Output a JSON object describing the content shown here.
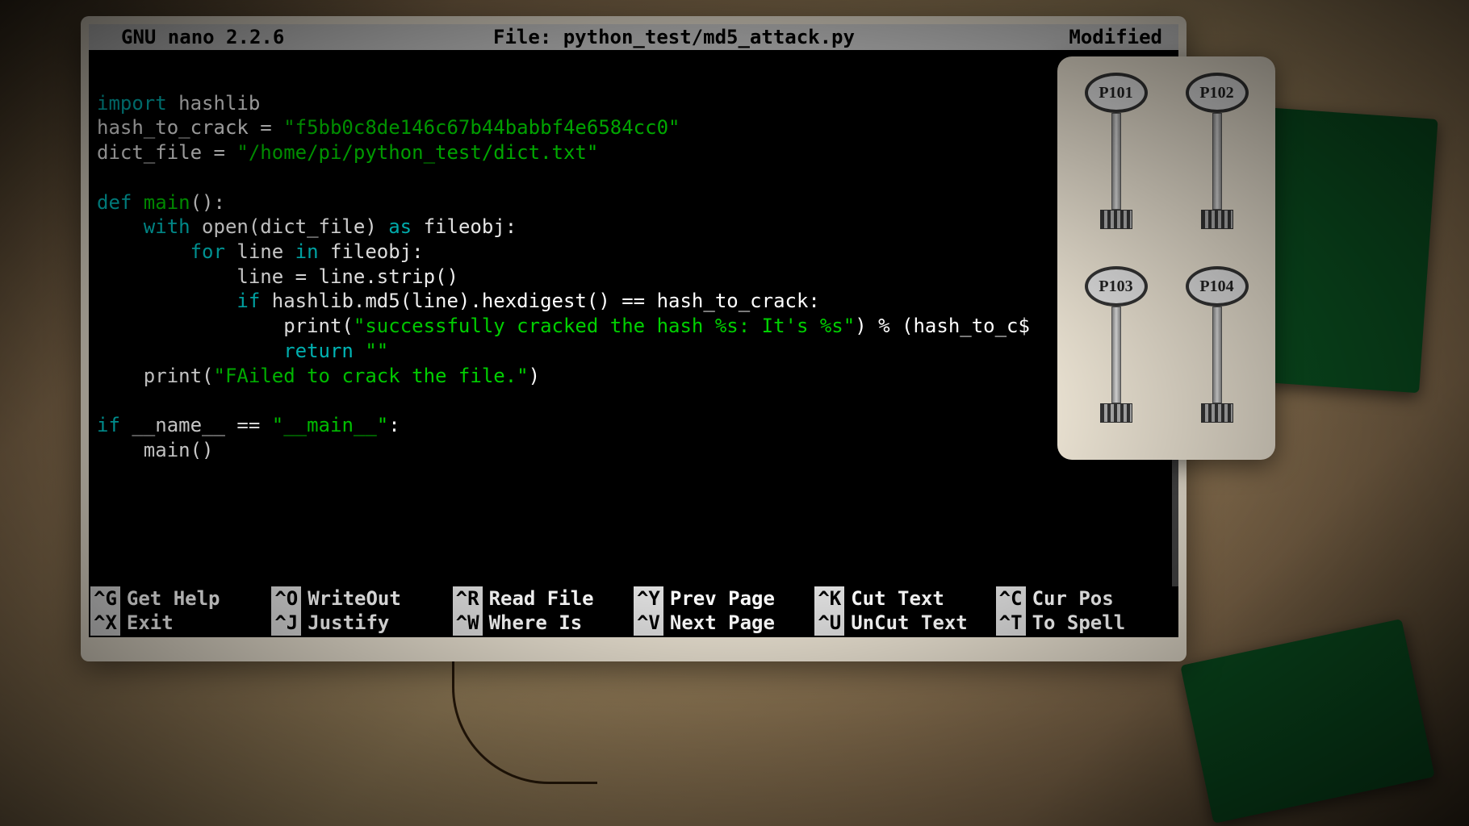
{
  "titlebar": {
    "app": "GNU nano 2.2.6",
    "file": "File: python_test/md5_attack.py",
    "status": "Modified"
  },
  "code": {
    "l1_kw": "import",
    "l1_rest": " hashlib",
    "l2_a": "hash_to_crack = ",
    "l2_str": "\"f5bb0c8de146c67b44babbf4e6584cc0\"",
    "l3_a": "dict_file = ",
    "l3_str": "\"/home/pi/python_test/dict.txt\"",
    "l5_kw": "def",
    "l5_fn": " main",
    "l5_rest": "():",
    "l6_pad": "    ",
    "l6_kw1": "with",
    "l6_mid": " open(dict_file) ",
    "l6_kw2": "as",
    "l6_rest": " fileobj:",
    "l7_pad": "        ",
    "l7_kw1": "for",
    "l7_mid": " line ",
    "l7_kw2": "in",
    "l7_rest": " fileobj:",
    "l8": "            line = line.strip()",
    "l9_pad": "            ",
    "l9_kw": "if",
    "l9_rest": " hashlib.md5(line).hexdigest() == hash_to_crack:",
    "l10_pad": "                print(",
    "l10_str": "\"successfully cracked the hash %s: It's %s\"",
    "l10_rest": ") % (hash_to_c$",
    "l11_pad": "                ",
    "l11_kw": "return",
    "l11_sp": " ",
    "l11_str": "\"\"",
    "l12_pad": "    print(",
    "l12_str": "\"FAiled to crack the file.\"",
    "l12_rest": ")",
    "l14_kw": "if",
    "l14_a": " __name__ == ",
    "l14_str": "\"__main__\"",
    "l14_rest": ":",
    "l15": "    main()"
  },
  "shortcuts": [
    {
      "key": "^G",
      "label": "Get Help"
    },
    {
      "key": "^O",
      "label": "WriteOut"
    },
    {
      "key": "^R",
      "label": "Read File"
    },
    {
      "key": "^Y",
      "label": "Prev Page"
    },
    {
      "key": "^K",
      "label": "Cut Text"
    },
    {
      "key": "^C",
      "label": "Cur Pos"
    },
    {
      "key": "^X",
      "label": "Exit"
    },
    {
      "key": "^J",
      "label": "Justify"
    },
    {
      "key": "^W",
      "label": "Where Is"
    },
    {
      "key": "^V",
      "label": "Next Page"
    },
    {
      "key": "^U",
      "label": "UnCut Text"
    },
    {
      "key": "^T",
      "label": "To Spell"
    }
  ],
  "keys": [
    {
      "label": "P101"
    },
    {
      "label": "P102"
    },
    {
      "label": "P103"
    },
    {
      "label": "P104"
    }
  ]
}
